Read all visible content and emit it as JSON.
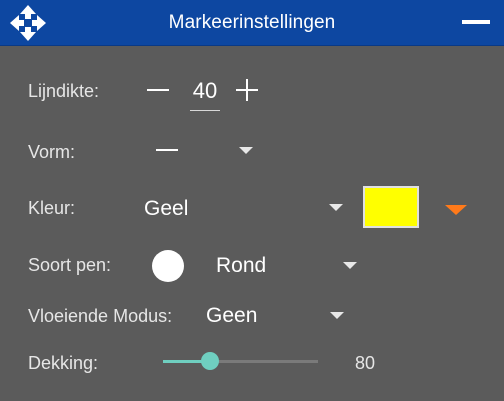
{
  "window": {
    "title": "Markeerinstellingen",
    "colors": {
      "titlebar": "#0d47a1",
      "panel": "#5b5b5b",
      "accent": "#6fcfc0",
      "picker_arrow": "#ff7a1a"
    },
    "icons": {
      "move": "move-arrows-icon",
      "minimize": "minimize-icon"
    }
  },
  "settings": {
    "line_width": {
      "label": "Lijndikte:",
      "value": "40",
      "decrease_icon": "minus-icon",
      "increase_icon": "plus-icon"
    },
    "shape": {
      "label": "Vorm:",
      "value_icon": "line-shape-icon",
      "dropdown_icon": "chevron-down-icon"
    },
    "color": {
      "label": "Kleur:",
      "value": "Geel",
      "swatch_color": "#ffff00",
      "dropdown_icon": "chevron-down-icon",
      "picker_icon": "orange-chevron-down-icon"
    },
    "pen_type": {
      "label": "Soort pen:",
      "value": "Rond",
      "pen_icon": "round-pen-icon",
      "dropdown_icon": "chevron-down-icon"
    },
    "smooth_mode": {
      "label": "Vloeiende Modus:",
      "value": "Geen",
      "dropdown_icon": "chevron-down-icon"
    },
    "opacity": {
      "label": "Dekking:",
      "value": "80",
      "fill_fraction": 0.3
    }
  }
}
